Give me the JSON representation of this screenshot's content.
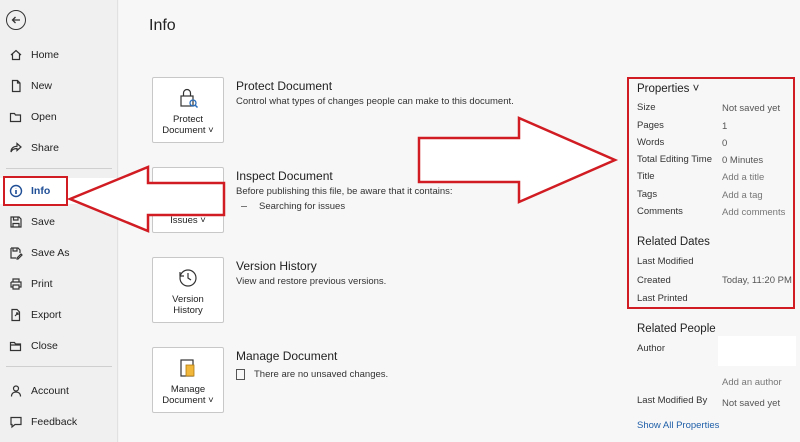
{
  "sidebar": {
    "items": [
      {
        "label": "Home"
      },
      {
        "label": "New"
      },
      {
        "label": "Open"
      },
      {
        "label": "Share"
      },
      {
        "label": "Info"
      },
      {
        "label": "Save"
      },
      {
        "label": "Save As"
      },
      {
        "label": "Print"
      },
      {
        "label": "Export"
      },
      {
        "label": "Close"
      },
      {
        "label": "Account"
      },
      {
        "label": "Feedback"
      }
    ]
  },
  "main": {
    "title": "Info",
    "sections": [
      {
        "button": [
          "Protect",
          "Document ˅"
        ],
        "title": "Protect Document",
        "desc": "Control what types of changes people can make to this document."
      },
      {
        "button": [
          "",
          "Issues ˅"
        ],
        "title": "Inspect Document",
        "desc": "Before publishing this file, be aware that it contains:",
        "sub": "Searching for issues"
      },
      {
        "button": [
          "Version",
          "History"
        ],
        "title": "Version History",
        "desc": "View and restore previous versions."
      },
      {
        "button": [
          "Manage",
          "Document ˅"
        ],
        "title": "Manage Document",
        "desc": "There are no unsaved changes."
      }
    ]
  },
  "properties": {
    "heading": "Properties ˅",
    "rows": [
      {
        "label": "Size",
        "value": "Not saved yet"
      },
      {
        "label": "Pages",
        "value": "1"
      },
      {
        "label": "Words",
        "value": "0"
      },
      {
        "label": "Total Editing Time",
        "value": "0 Minutes"
      },
      {
        "label": "Title",
        "value": "Add a title"
      },
      {
        "label": "Tags",
        "value": "Add a tag"
      },
      {
        "label": "Comments",
        "value": "Add comments"
      }
    ],
    "dates_heading": "Related Dates",
    "dates": [
      {
        "label": "Last Modified",
        "value": ""
      },
      {
        "label": "Created",
        "value": "Today, 11:20 PM"
      },
      {
        "label": "Last Printed",
        "value": ""
      }
    ],
    "people_heading": "Related People",
    "author_label": "Author",
    "add_author": "Add an author",
    "last_modified_by_label": "Last Modified By",
    "last_modified_by_value": "Not saved yet",
    "show_all": "Show All Properties"
  }
}
